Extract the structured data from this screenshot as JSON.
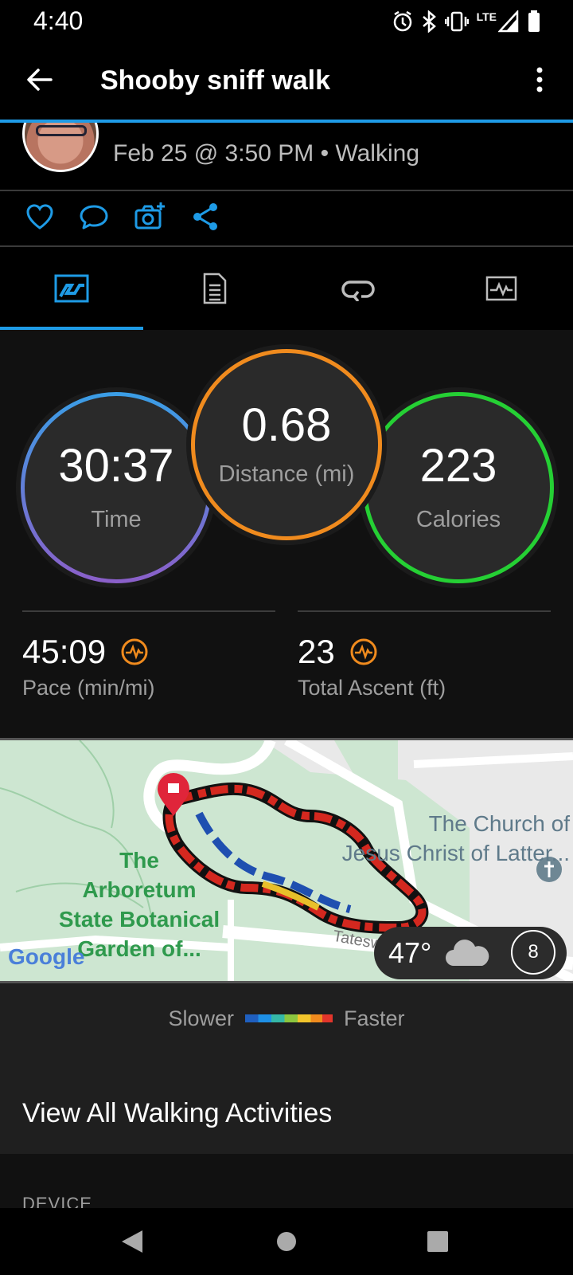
{
  "status_bar": {
    "time": "4:40",
    "network": "LTE",
    "icons": [
      "alarm-icon",
      "bluetooth-icon",
      "vibrate-icon",
      "signal-icon",
      "battery-icon"
    ]
  },
  "app_bar": {
    "title": "Shooby sniff walk",
    "back_icon": "arrow-left-icon",
    "more_icon": "more-vert-icon"
  },
  "header": {
    "meta": "Feb 25 @ 3:50 PM • Walking"
  },
  "actions": [
    "like-icon",
    "comment-icon",
    "add-photo-icon",
    "share-icon"
  ],
  "tabs": [
    {
      "icon": "overview-icon",
      "selected": true
    },
    {
      "icon": "details-icon",
      "selected": false
    },
    {
      "icon": "laps-icon",
      "selected": false
    },
    {
      "icon": "charts-icon",
      "selected": false
    }
  ],
  "stats": {
    "time": {
      "value": "30:37",
      "label": "Time"
    },
    "distance": {
      "value": "0.68",
      "label": "Distance (mi)"
    },
    "calories": {
      "value": "223",
      "label": "Calories"
    },
    "pace": {
      "value": "45:09",
      "label": "Pace (min/mi)"
    },
    "ascent": {
      "value": "23",
      "label": "Total Ascent (ft)"
    }
  },
  "map": {
    "place_main": "The\nArboretum\nState Botanical\nGarden of...",
    "place_church": "The Church of\nJesus Christ of Latter...",
    "street": "Tatesw",
    "google": "Google",
    "weather_temp": "47°",
    "moon_phase": "8"
  },
  "legend": {
    "slower": "Slower",
    "faster": "Faster"
  },
  "view_all": "View All Walking Activities",
  "device_label": "DEVICE",
  "colors": {
    "accent_blue": "#1e9be6",
    "time_ring": "#3a9ee6",
    "distance_ring": "#f08b1e",
    "calories_ring": "#25d034",
    "hr_icon": "#f08b1e"
  }
}
